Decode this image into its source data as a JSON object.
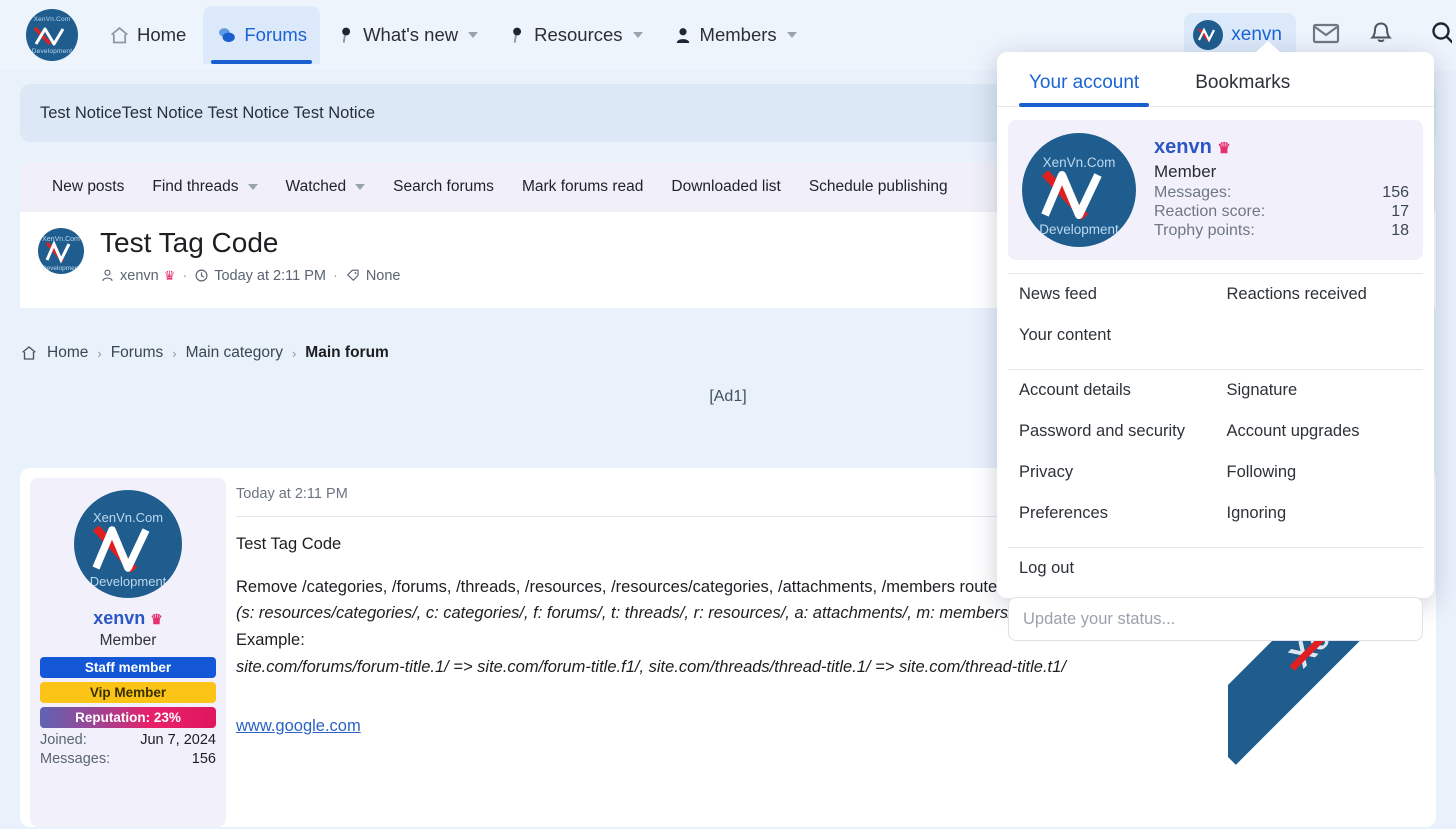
{
  "site": {
    "logo_top": "XenVn.Com",
    "logo_bottom": "Development",
    "watermark": "XenVn.Com"
  },
  "topnav": {
    "items": [
      {
        "label": "Home",
        "icon": "home-icon",
        "active": false,
        "caret": false
      },
      {
        "label": "Forums",
        "icon": "forums-icon",
        "active": true,
        "caret": false
      },
      {
        "label": "What's new",
        "icon": "whats-new-icon",
        "active": false,
        "caret": true
      },
      {
        "label": "Resources",
        "icon": "resources-icon",
        "active": false,
        "caret": true
      },
      {
        "label": "Members",
        "icon": "members-icon",
        "active": false,
        "caret": true
      }
    ],
    "account_name": "xenvn",
    "icons": [
      "envelope-icon",
      "bell-icon",
      "search-icon"
    ]
  },
  "notice": {
    "text": "Test NoticeTest Notice Test Notice Test Notice"
  },
  "subnav": {
    "items": [
      {
        "label": "New posts",
        "caret": false
      },
      {
        "label": "Find threads",
        "caret": true
      },
      {
        "label": "Watched",
        "caret": true
      },
      {
        "label": "Search forums",
        "caret": false
      },
      {
        "label": "Mark forums read",
        "caret": false
      },
      {
        "label": "Downloaded list",
        "caret": false
      },
      {
        "label": "Schedule publishing",
        "caret": false
      }
    ]
  },
  "thread": {
    "title": "Test Tag Code",
    "author": "xenvn",
    "date": "Today at 2:11 PM",
    "tags_label": "None",
    "dot": "·"
  },
  "breadcrumb": {
    "home_icon": "home-outline-icon",
    "items": [
      "Home",
      "Forums",
      "Main category"
    ],
    "current": "Main forum",
    "chevron": "›"
  },
  "ad": {
    "label": "[Ad1]"
  },
  "post": {
    "author": "xenvn",
    "role": "Member",
    "badges": [
      {
        "label": "Staff member",
        "style": "b-staff"
      },
      {
        "label": "Vip Member",
        "style": "b-vip"
      },
      {
        "label": "Reputation: 23%",
        "style": "b-rep"
      }
    ],
    "stats": [
      {
        "key": "Joined:",
        "value": "Jun 7, 2024"
      },
      {
        "key": "Messages:",
        "value": "156"
      }
    ],
    "timestamp": "Today at 2:11 PM",
    "body_title": "Test Tag Code",
    "body_line1": "Remove /categories, /forums, /threads, /resources, /resources/categories, /attachments, /members routes in URL",
    "body_line2": "(s: resources/categories/, c: categories/, f: forums/, t: threads/, r: resources/, a: attachments/, m: members/)",
    "body_line3": "Example:",
    "body_line4": "site.com/forums/forum-title.1/ => site.com/forum-title.f1/, site.com/threads/thread-title.1/ => site.com/thread-title.t1/",
    "link": "www.google.com",
    "more_dots": "•••"
  },
  "account_menu": {
    "tabs": [
      {
        "label": "Your account",
        "active": true
      },
      {
        "label": "Bookmarks",
        "active": false
      }
    ],
    "username": "xenvn",
    "role": "Member",
    "stats": [
      {
        "key": "Messages:",
        "value": "156"
      },
      {
        "key": "Reaction score:",
        "value": "17"
      },
      {
        "key": "Trophy points:",
        "value": "18"
      }
    ],
    "group1": [
      {
        "left": "News feed",
        "right": "Reactions received"
      },
      {
        "left": "Your content",
        "right": ""
      }
    ],
    "group2": [
      {
        "left": "Account details",
        "right": "Signature"
      },
      {
        "left": "Password and security",
        "right": "Account upgrades"
      },
      {
        "left": "Privacy",
        "right": "Following"
      },
      {
        "left": "Preferences",
        "right": "Ignoring"
      }
    ],
    "group3": [
      {
        "left": "Log out",
        "right": ""
      }
    ],
    "status_placeholder": "Update your status...",
    "status_value": ""
  },
  "colors": {
    "page_bg": "#e9f1fb",
    "nav_bg": "#eef4fc",
    "accent": "#1a64d4",
    "notice_bg": "#dce8f5",
    "subnav_bg": "#f1f0f9",
    "brand_blue": "#1f5d8e",
    "crown_pink": "#e62f6e",
    "badge_blue": "#1356d6",
    "badge_yellow": "#fbc417",
    "link_blue": "#2b63c4"
  }
}
